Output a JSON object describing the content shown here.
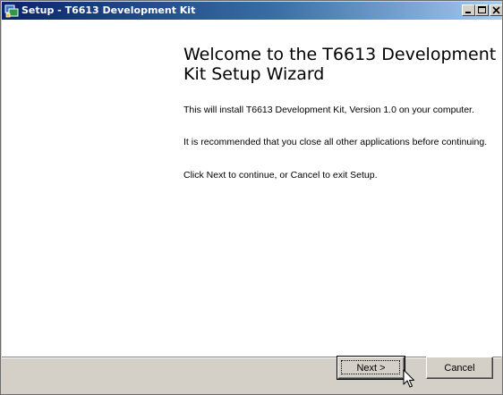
{
  "window": {
    "title": "Setup - T6613 Development Kit",
    "icon": "setup-installer-icon",
    "controls": [
      "minimize-icon",
      "maximize-icon",
      "close-icon"
    ]
  },
  "wizard": {
    "heading": "Welcome to the T6613 Development Kit Setup Wizard",
    "paragraphs": [
      "This will install T6613 Development Kit, Version 1.0 on your computer.",
      "It is recommended that you close all other applications before continuing.",
      "Click Next to continue, or Cancel to exit Setup."
    ]
  },
  "buttons": {
    "next_label": "Next >",
    "cancel_label": "Cancel"
  },
  "cursor": {
    "icon": "mouse-pointer-icon",
    "hovering": "next-button"
  },
  "colors": {
    "titlebar_start": "#0a246a",
    "titlebar_end": "#a6caf0",
    "dialog_face": "#d4d0c8",
    "content_bg": "#ffffff"
  }
}
